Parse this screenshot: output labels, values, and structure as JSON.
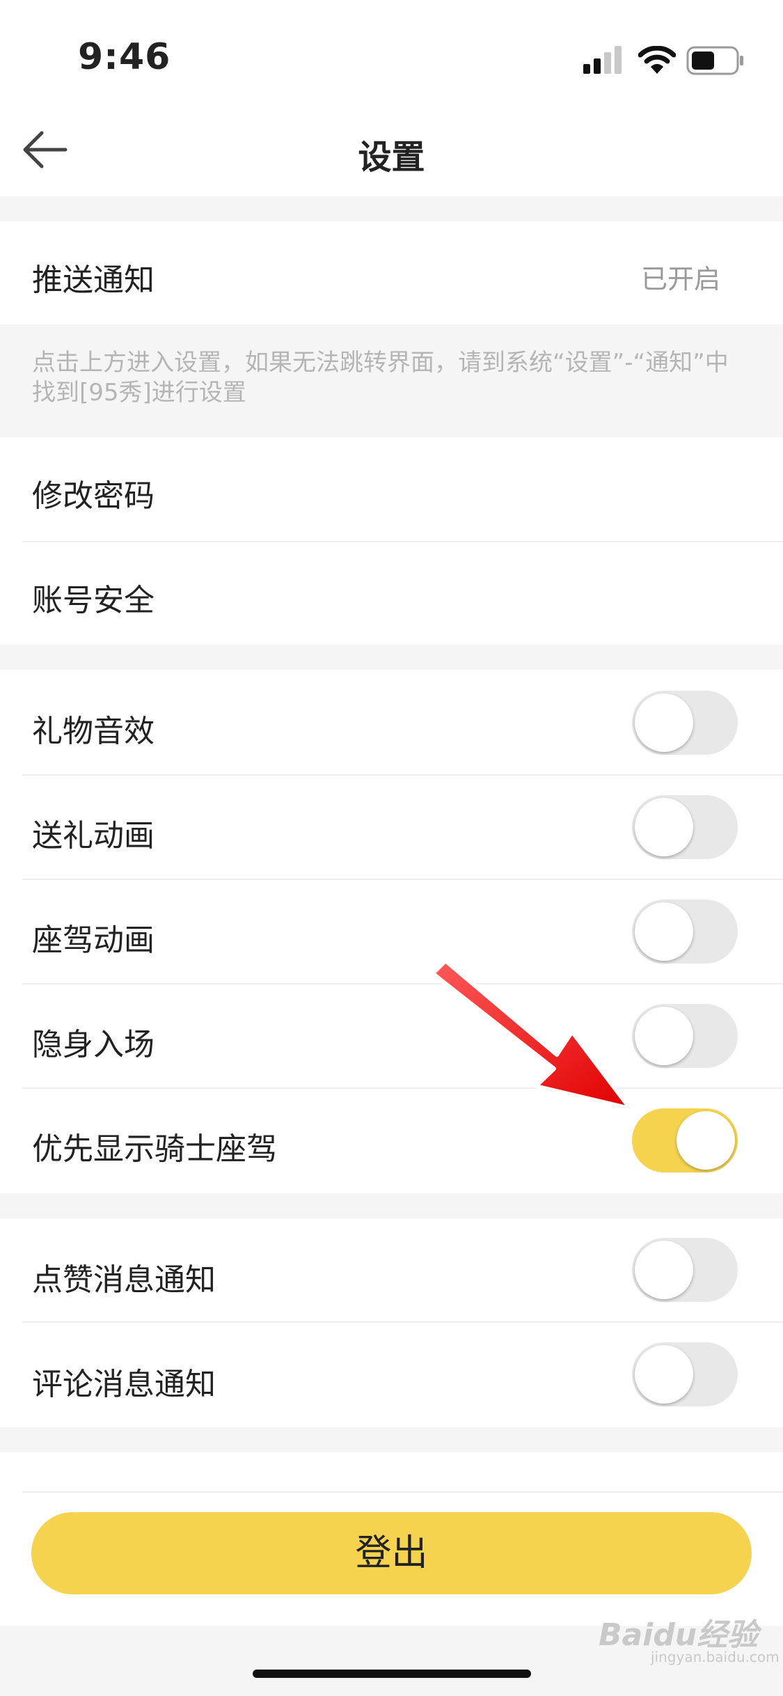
{
  "status_bar": {
    "time": "9:46"
  },
  "nav": {
    "title": "设置"
  },
  "push": {
    "label": "推送通知",
    "value": "已开启"
  },
  "hint": "点击上方进入设置，如果无法跳转界面，请到系统“设置”-“通知”中找到[95秀]进行设置",
  "account": {
    "change_password": "修改密码",
    "account_security": "账号安全"
  },
  "toggles": [
    {
      "label": "礼物音效",
      "on": false
    },
    {
      "label": "送礼动画",
      "on": false
    },
    {
      "label": "座驾动画",
      "on": false
    },
    {
      "label": "隐身入场",
      "on": false
    },
    {
      "label": "优先显示骑士座驾",
      "on": true
    },
    {
      "label": "点赞消息通知",
      "on": false
    },
    {
      "label": "评论消息通知",
      "on": false
    }
  ],
  "logout_label": "登出",
  "watermark": {
    "brand": "Baidu经验",
    "url": "jingyan.baidu.com"
  },
  "colors": {
    "accent": "#f5d34f",
    "annotation_arrow": "#ff1a1a"
  }
}
